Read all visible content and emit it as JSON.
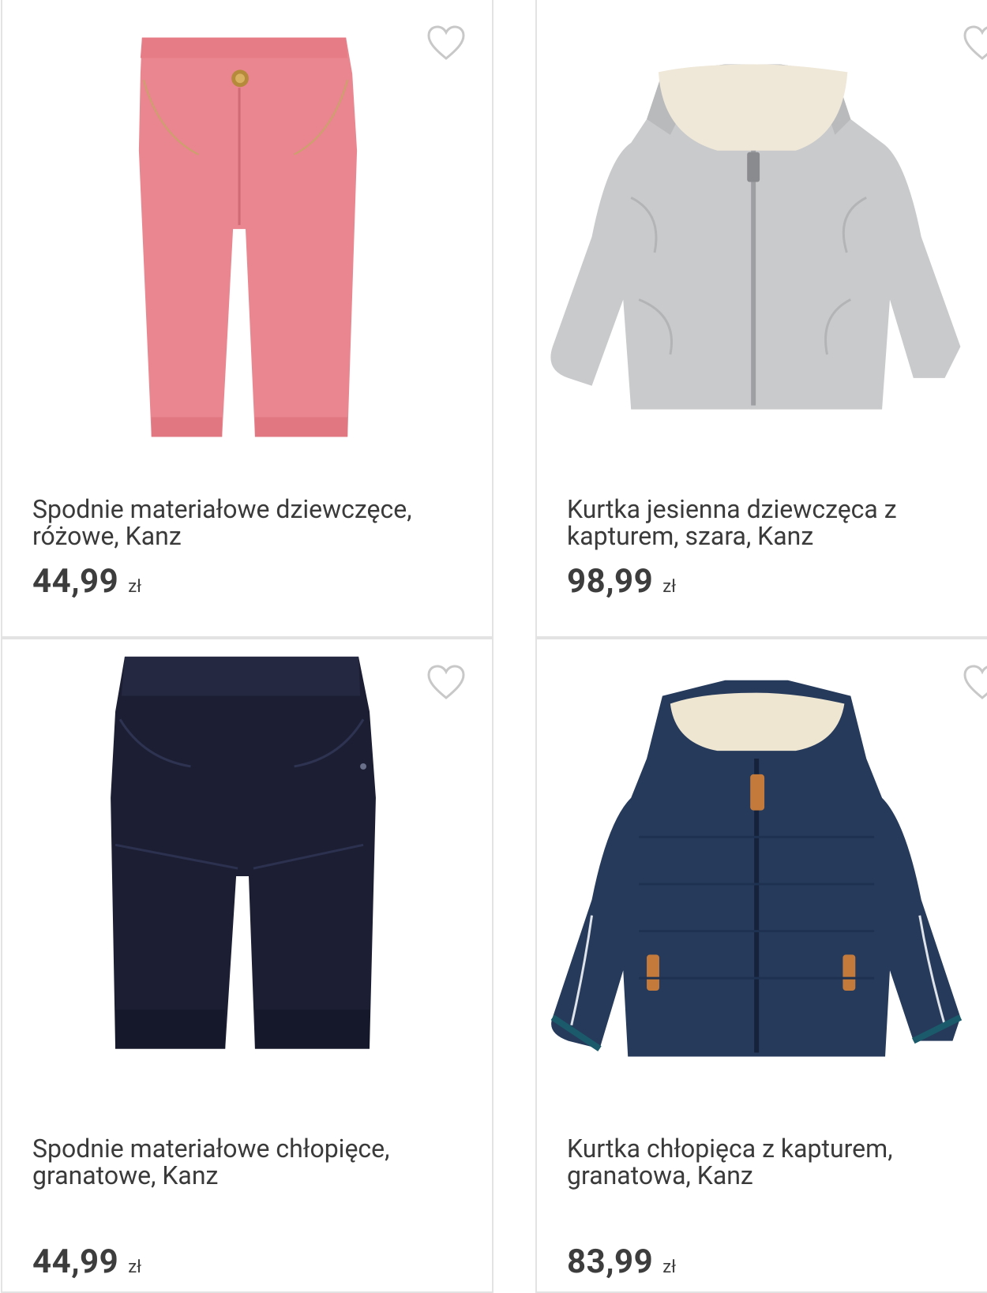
{
  "products": [
    {
      "title": "Spodnie materiałowe dziewczęce, różowe, Kanz",
      "price": "44,99",
      "currency": "zł",
      "image": "pink-corduroy-pants",
      "color": "#e9868f"
    },
    {
      "title": "Kurtka jesienna dziewczęca z kapturem, szara, Kanz",
      "price": "98,99",
      "currency": "zł",
      "image": "grey-quilted-hooded-jacket",
      "color": "#c9cacc"
    },
    {
      "title": "Spodnie materiałowe chłopięce, granatowe, Kanz",
      "price": "44,99",
      "currency": "zł",
      "image": "navy-cargo-pants",
      "color": "#1c1f33"
    },
    {
      "title": "Kurtka chłopięca z kapturem, granatowa, Kanz",
      "price": "83,99",
      "currency": "zł",
      "image": "navy-puffer-hooded-jacket",
      "color": "#263a5c"
    }
  ],
  "colors": {
    "card_border": "#e3e3e3",
    "text": "#3a3a3a",
    "heart_outline": "#c8c8c8"
  }
}
